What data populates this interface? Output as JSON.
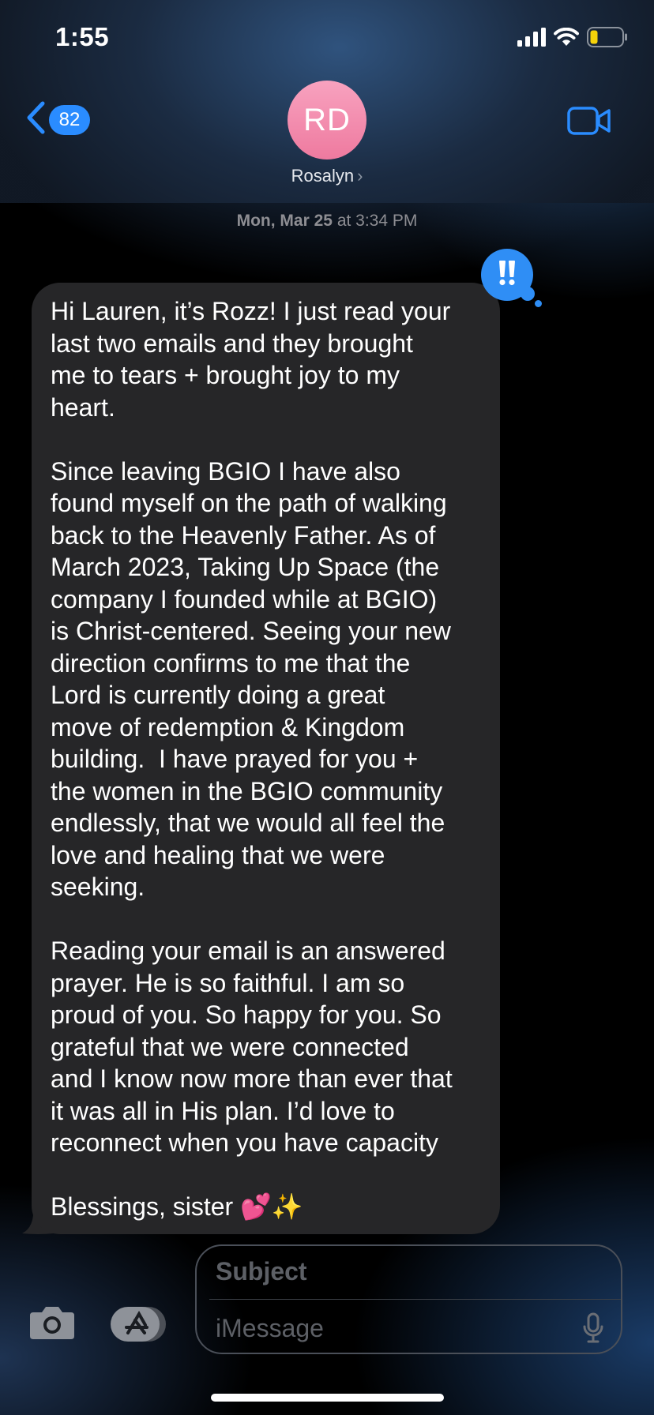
{
  "status_bar": {
    "time": "1:55",
    "icons": [
      "signal-icon",
      "wifi-icon",
      "battery-icon"
    ],
    "battery_color": "#f5d20a"
  },
  "header": {
    "back_badge": "82",
    "avatar_initials": "RD",
    "contact_name": "Rosalyn",
    "contact_chevron": "›",
    "accent_color": "#2a8cff",
    "avatar_color": "#f08aaa"
  },
  "thread": {
    "timestamp_day": "Mon, Mar 25",
    "timestamp_time": "at 3:34 PM",
    "reaction": "!!",
    "message": "Hi Lauren, it’s Rozz! I just read your\nlast two emails and they brought\nme to tears + brought joy to my\nheart.\n\nSince leaving BGIO I have also\nfound myself on the path of walking\nback to the Heavenly Father. As of\nMarch 2023, Taking Up Space (the\ncompany I founded while at BGIO)\nis Christ-centered. Seeing your new\ndirection confirms to me that the\nLord is currently doing a great\nmove of redemption & Kingdom\nbuilding.  I have prayed for you +\nthe women in the BGIO community\nendlessly, that we would all feel the\nlove and healing that we were\nseeking.\n\nReading your email is an answered\nprayer. He is so faithful. I am so\nproud of you. So happy for you. So\ngrateful that we were connected\nand I know now more than ever that\nit was all in His plan. I’d love to\nreconnect when you have capacity\n\nBlessings, sister 💕✨"
  },
  "composer": {
    "subject_placeholder": "Subject",
    "message_placeholder": "iMessage"
  }
}
